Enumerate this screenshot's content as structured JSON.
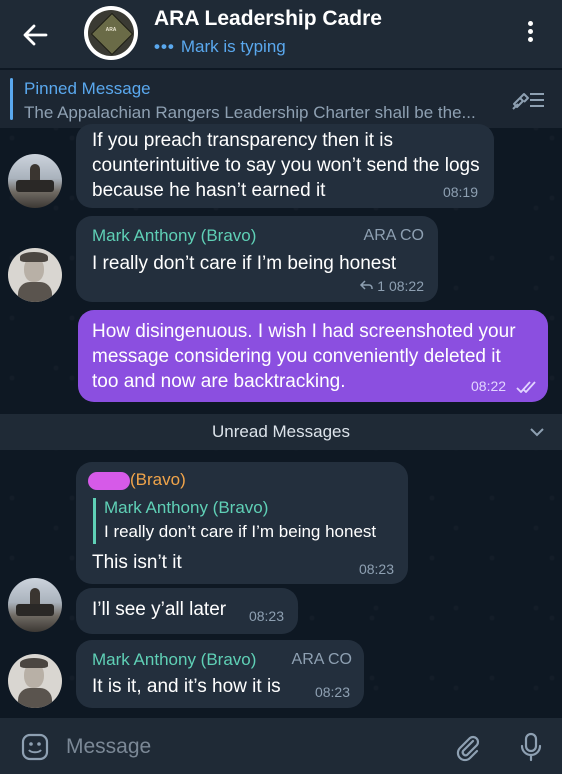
{
  "header": {
    "title": "ARA Leadership Cadre",
    "status_dots": "•••",
    "status": "Mark is typing",
    "avatar_text": "ARA"
  },
  "pinned": {
    "title": "Pinned Message",
    "text": "The Appalachian Rangers Leadership Charter shall be the..."
  },
  "messages": [
    {
      "text": "If you preach transparency then it is counterintuitive to say you won’t send the logs because he hasn’t earned it",
      "time": "08:19"
    },
    {
      "sender": "Mark Anthony (Bravo)",
      "role": "ARA CO",
      "text": "I really don’t care if I’m being honest",
      "replies": "1",
      "time": "08:22"
    },
    {
      "text": "How disingenuous. I wish I had screenshoted your message considering you conveniently deleted it too and now are backtracking.",
      "time": "08:22"
    },
    {
      "sender_suffix": "(Bravo)",
      "quote_sender": "Mark Anthony (Bravo)",
      "quote_text": "I really don’t care if I’m being honest",
      "text": "This isn’t it",
      "time": "08:23"
    },
    {
      "text": "I’ll see y’all later",
      "time": "08:23"
    },
    {
      "sender": "Mark Anthony (Bravo)",
      "role": "ARA CO",
      "text": "It is it, and it’s how it is",
      "time": "08:23"
    }
  ],
  "unread_label": "Unread Messages",
  "input": {
    "placeholder": "Message"
  },
  "colors": {
    "header_bg": "#1f2a36",
    "accent_blue": "#5aa8ee",
    "sender_teal": "#5fd0b6",
    "outgoing_bubble": "#8b4fe0",
    "incoming_bubble": "#232f3d"
  }
}
